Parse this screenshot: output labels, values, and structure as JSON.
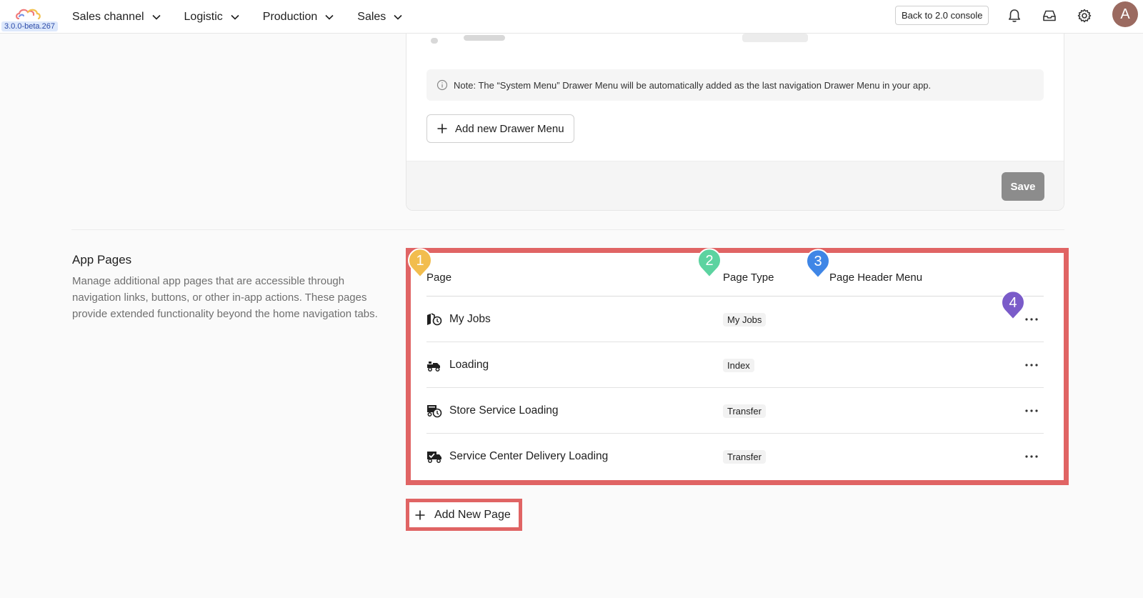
{
  "app": {
    "version": "3.0.0-beta.267"
  },
  "nav": {
    "items": [
      {
        "label": "Sales channel"
      },
      {
        "label": "Logistic"
      },
      {
        "label": "Production"
      },
      {
        "label": "Sales"
      }
    ],
    "console_button": "Back to 2.0 console",
    "avatar_initial": "A"
  },
  "drawer_section": {
    "note": "Note: The “System Menu” Drawer Menu will be automatically added as the last navigation Drawer Menu in your app.",
    "add_button": "Add new Drawer Menu",
    "save_button": "Save"
  },
  "app_pages": {
    "title": "App Pages",
    "description": "Manage additional app pages that are accessible through navigation links, buttons, or other in-app actions. These pages provide extended functionality beyond the home navigation tabs.",
    "columns": {
      "page": "Page",
      "page_type": "Page Type",
      "page_header_menu": "Page Header Menu"
    },
    "rows": [
      {
        "name": "My Jobs",
        "type": "My Jobs",
        "icon": "map-marker-icon"
      },
      {
        "name": "Loading",
        "type": "Index",
        "icon": "truck-loading-icon"
      },
      {
        "name": "Store Service Loading",
        "type": "Transfer",
        "icon": "truck-clock-icon"
      },
      {
        "name": "Service Center Delivery Loading",
        "type": "Transfer",
        "icon": "truck-check-icon"
      }
    ],
    "add_button": "Add New Page"
  },
  "markers": [
    {
      "number": "1",
      "color": "#f2bd4e"
    },
    {
      "number": "2",
      "color": "#5cd3a0"
    },
    {
      "number": "3",
      "color": "#3f86e6"
    },
    {
      "number": "4",
      "color": "#7a5bc9"
    }
  ],
  "colors": {
    "highlight": "#e06464",
    "save_disabled": "#8c8c8c"
  }
}
